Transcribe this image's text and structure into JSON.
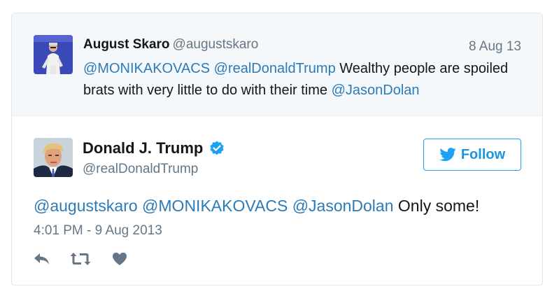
{
  "parent_tweet": {
    "author_name": "August Skaro",
    "author_handle": "@augustskaro",
    "date": "8 Aug 13",
    "mention_1": "@MONIKAKOVACS",
    "mention_2": "@realDonaldTrump",
    "text_body": " Wealthy people are spoiled brats with very little to do with their time ",
    "mention_3": "@JasonDolan"
  },
  "main_tweet": {
    "author_name": "Donald J. Trump",
    "author_handle": "@realDonaldTrump",
    "verified": true,
    "follow_label": "Follow",
    "mention_1": "@augustskaro",
    "mention_2": "@MONIKAKOVACS",
    "mention_3": "@JasonDolan",
    "text_body": " Only some!",
    "timestamp": "4:01 PM - 9 Aug 2013"
  },
  "icons": {
    "reply": "reply-icon",
    "retweet": "retweet-icon",
    "like": "heart-icon",
    "follow": "twitter-bird-icon",
    "verified": "verified-badge-icon"
  },
  "colors": {
    "link": "#2b7bb9",
    "accent": "#1da1f2",
    "muted": "#657786",
    "icon": "#657786",
    "parent_bg": "#f5f8fa"
  }
}
